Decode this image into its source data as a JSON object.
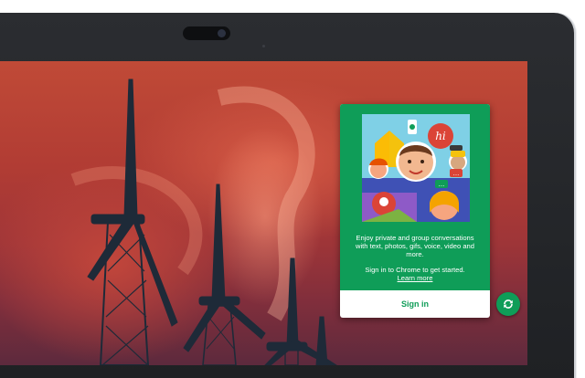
{
  "device": {
    "camera_icon": "webcam-icon"
  },
  "popup": {
    "illustration_icon": "hangouts-illustration",
    "illustration_bubbles": {
      "hi": "hi",
      "ellipsis_a": "...",
      "ellipsis_b": "..."
    },
    "description": "Enjoy private and group conversations with text, photos, gifs, voice, video and more.",
    "signin_prompt": "Sign in to Chrome to get started.",
    "learn_more": "Learn more",
    "signin_button": "Sign in"
  },
  "tray": {
    "hangouts_icon": "hangouts-refresh-icon"
  },
  "colors": {
    "hangouts_green": "#0f9d58",
    "bezel": "#1f2124"
  }
}
